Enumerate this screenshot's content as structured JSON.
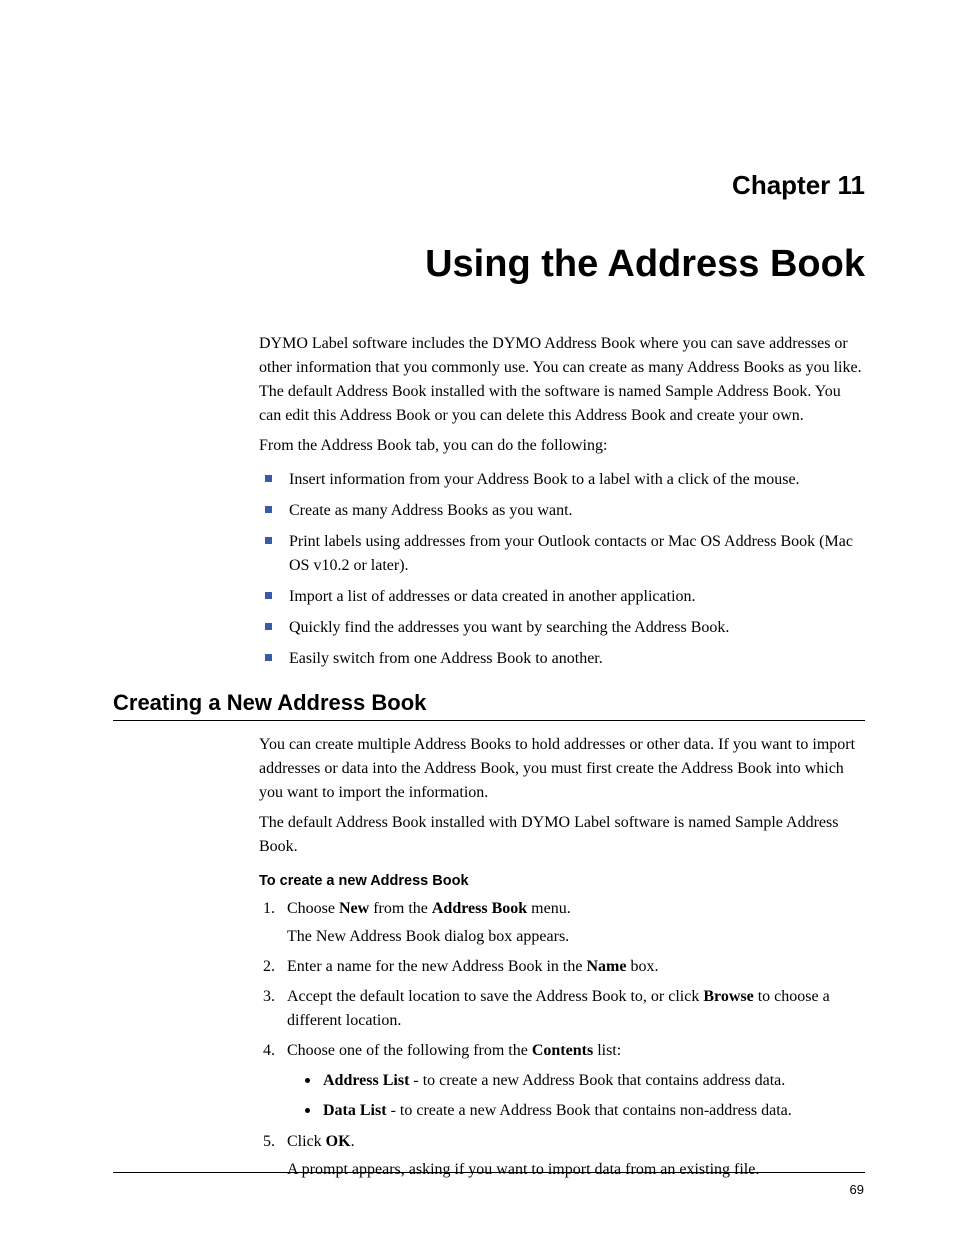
{
  "chapter": {
    "label": "Chapter 11",
    "title": "Using the Address Book"
  },
  "intro": {
    "p1": "DYMO Label software includes the DYMO Address Book where you can save addresses or other information that you commonly use. You can create as many Address Books as you like. The default Address Book installed with the software is named Sample Address Book. You can edit this Address Book or you can delete this Address Book and create your own.",
    "p2": "From the Address Book tab, you can do the following:",
    "bullets": [
      "Insert information from your Address Book to a label with a click of the mouse.",
      "Create as many Address Books as you want.",
      "Print labels using addresses from your Outlook contacts or Mac OS Address Book (Mac OS v10.2 or later).",
      "Import a list of addresses or data created in another application.",
      "Quickly find the addresses you want by searching the Address Book.",
      "Easily switch from one Address Book to another."
    ]
  },
  "section": {
    "heading": "Creating a New Address Book",
    "p1": "You can create multiple Address Books to hold addresses or other data. If you want to import addresses or data into the Address Book, you must first create the Address Book into which you want to import the information.",
    "p2": "The default Address Book installed with DYMO Label software is named Sample Address Book.",
    "subheading": "To create a new Address Book",
    "steps": {
      "s1_pre": "Choose ",
      "s1_bold1": "New",
      "s1_mid": " from the ",
      "s1_bold2": "Address Book",
      "s1_post": " menu.",
      "s1_sub": "The New Address Book dialog box appears.",
      "s2_pre": "Enter a name for the new Address Book in the ",
      "s2_bold": "Name",
      "s2_post": " box.",
      "s3_pre": "Accept the default location to save the Address Book to, or click ",
      "s3_bold": "Browse",
      "s3_post": " to choose a different location.",
      "s4_pre": "Choose one of the following from the ",
      "s4_bold": "Contents",
      "s4_post": " list:",
      "s4_sub1_bold": "Address List",
      "s4_sub1_rest": " - to create a new Address Book that contains address data.",
      "s4_sub2_bold": "Data List",
      "s4_sub2_rest": " - to create a new Address Book that contains non-address data.",
      "s5_pre": "Click ",
      "s5_bold": "OK",
      "s5_post": ".",
      "s5_sub": "A prompt appears, asking if you want to import data from an existing file."
    }
  },
  "pageNumber": "69"
}
